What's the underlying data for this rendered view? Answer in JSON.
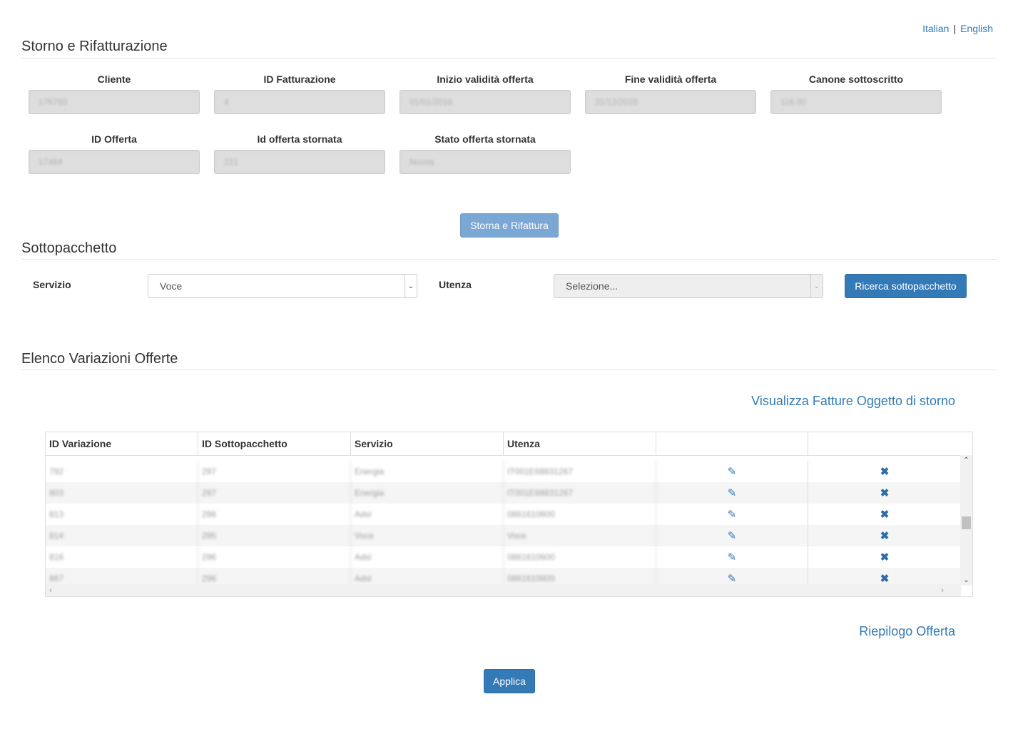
{
  "language": {
    "italian": "Italian",
    "separator": "|",
    "english": "English"
  },
  "section1": {
    "title": "Storno e Rifatturazione",
    "fields_row1": [
      {
        "label": "Cliente",
        "value": "176793"
      },
      {
        "label": "ID Fatturazione",
        "value": "4"
      },
      {
        "label": "Inizio validità offerta",
        "value": "01/01/2016"
      },
      {
        "label": "Fine validità offerta",
        "value": "31/12/2016"
      },
      {
        "label": "Canone sottoscritto",
        "value": "116.00"
      }
    ],
    "fields_row2": [
      {
        "label": "ID Offerta",
        "value": "17464"
      },
      {
        "label": "Id offerta stornata",
        "value": "221"
      },
      {
        "label": "Stato offerta stornata",
        "value": "Nuova"
      }
    ],
    "button": "Storna e Rifattura"
  },
  "section2": {
    "title": "Sottopacchetto",
    "servizio_label": "Servizio",
    "servizio_value": "Voce",
    "utenza_label": "Utenza",
    "utenza_value": "Selezione...",
    "search_button": "Ricerca sottopacchetto"
  },
  "section3": {
    "title": "Elenco Variazioni Offerte",
    "link_invoices": "Visualizza Fatture Oggetto di storno",
    "columns": [
      "ID Variazione",
      "ID Sottopacchetto",
      "Servizio",
      "Utenza",
      "",
      ""
    ],
    "rows": [
      {
        "id": "792",
        "sub": "297",
        "service": "Energia",
        "user": "IT001E68831267"
      },
      {
        "id": "803",
        "sub": "297",
        "service": "Energia",
        "user": "IT001E68831267"
      },
      {
        "id": "813",
        "sub": "296",
        "service": "Adsl",
        "user": "0861610600"
      },
      {
        "id": "814",
        "sub": "295",
        "service": "Voce",
        "user": "Voce"
      },
      {
        "id": "816",
        "sub": "296",
        "service": "Adsl",
        "user": "0861610600"
      },
      {
        "id": "867",
        "sub": "296",
        "service": "Adsl",
        "user": "0861610600"
      }
    ],
    "edit_icon": "✎",
    "delete_icon": "✖",
    "link_summary": "Riepilogo Offerta",
    "apply_button": "Applica"
  },
  "colors": {
    "primary": "#337ab7",
    "disabled_primary": "#7aa7d3",
    "input_bg": "#dedede"
  }
}
